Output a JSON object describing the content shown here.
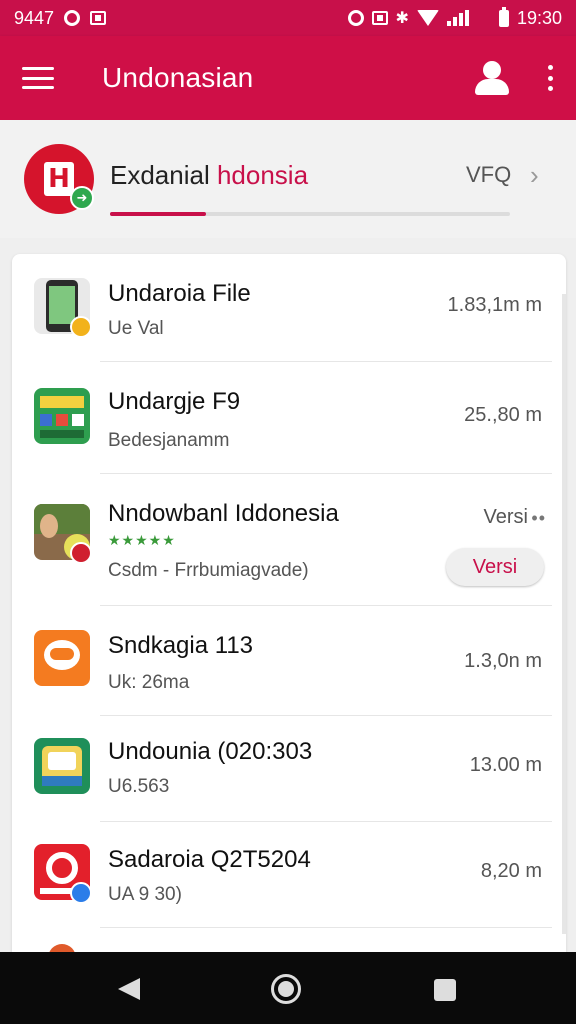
{
  "status_bar": {
    "left_text": "9447",
    "time": "19:30"
  },
  "app_bar": {
    "title": "Undonasian",
    "icons": [
      "menu-icon",
      "account-icon",
      "more-vert-icon"
    ]
  },
  "featured": {
    "title_main": "Exdanial ",
    "title_accent": "hdonsia",
    "faq": "VFQ",
    "progress_fraction": 0.24,
    "logo_glyph": "H"
  },
  "list": [
    {
      "title": "Undaroia File",
      "subtitle": "Ue Val",
      "size": "1.83,1m m",
      "icon": "phone-app-icon"
    },
    {
      "title": "Undargje F9",
      "subtitle": "Bedesjanamm",
      "size": "25.,80 m",
      "icon": "grid-app-icon"
    },
    {
      "title": "Nndowbanl Iddonesia",
      "subtitle": "Csdm - Frrbumiagvade)",
      "size": "Versi",
      "action": "Versi",
      "icon": "photo-app-icon"
    },
    {
      "title": "Sndkagia 113",
      "subtitle": "Uk: 26ma",
      "size": "1.3,0n m",
      "icon": "chat-app-icon"
    },
    {
      "title": "Undounia (020:303",
      "subtitle": "U6.563",
      "size": "13.00 m",
      "icon": "receipt-app-icon"
    },
    {
      "title": "Sadaroia Q2T5204",
      "subtitle": "UA 9 30)",
      "size": "8,20 m",
      "icon": "ring-app-icon"
    }
  ],
  "colors": {
    "primary": "#cf0f47",
    "accent": "#c8104a"
  }
}
